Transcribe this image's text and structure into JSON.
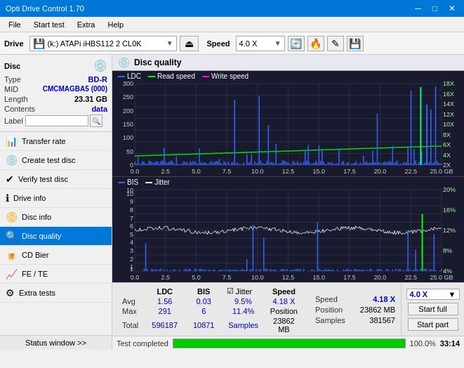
{
  "titleBar": {
    "title": "Opti Drive Control 1.70",
    "minimize": "─",
    "maximize": "□",
    "close": "✕"
  },
  "menuBar": {
    "items": [
      "File",
      "Start test",
      "Extra",
      "Help"
    ]
  },
  "toolbar": {
    "driveLabel": "Drive",
    "driveText": "(k:) ATAPi iHBS112  2 CL0K",
    "speedLabel": "Speed",
    "speedValue": "4.0 X"
  },
  "discPanel": {
    "label": "Disc",
    "type": "BD-R",
    "mid": "CMCMAGBA5 (000)",
    "length": "23.31 GB",
    "contents": "data",
    "labelText": ""
  },
  "navItems": [
    {
      "id": "transfer-rate",
      "label": "Transfer rate",
      "icon": "📊"
    },
    {
      "id": "create-test-disc",
      "label": "Create test disc",
      "icon": "💿"
    },
    {
      "id": "verify-test-disc",
      "label": "Verify test disc",
      "icon": "✔"
    },
    {
      "id": "drive-info",
      "label": "Drive info",
      "icon": "ℹ"
    },
    {
      "id": "disc-info",
      "label": "Disc info",
      "icon": "📀"
    },
    {
      "id": "disc-quality",
      "label": "Disc quality",
      "icon": "🔍",
      "active": true
    },
    {
      "id": "cd-bier",
      "label": "CD Bier",
      "icon": "📀"
    },
    {
      "id": "fe-te",
      "label": "FE / TE",
      "icon": "📈"
    },
    {
      "id": "extra-tests",
      "label": "Extra tests",
      "icon": "⚙"
    }
  ],
  "statusWindow": "Status window >>",
  "panelHeader": "Disc quality",
  "chart1": {
    "legend": [
      {
        "label": "LDC",
        "color": "#3366ff"
      },
      {
        "label": "Read speed",
        "color": "#00ff00"
      },
      {
        "label": "Write speed",
        "color": "#ff00ff"
      }
    ],
    "yAxisLeft": [
      "300",
      "250",
      "200",
      "150",
      "100",
      "50",
      "0"
    ],
    "yAxisRight": [
      "18X",
      "16X",
      "14X",
      "12X",
      "10X",
      "8X",
      "6X",
      "4X",
      "2X"
    ],
    "xAxis": [
      "0.0",
      "2.5",
      "5.0",
      "7.5",
      "10.0",
      "12.5",
      "15.0",
      "17.5",
      "20.0",
      "22.5",
      "25.0 GB"
    ]
  },
  "chart2": {
    "legend": [
      {
        "label": "BIS",
        "color": "#3366ff"
      },
      {
        "label": "Jitter",
        "color": "#ffffff"
      }
    ],
    "yAxisLeft": [
      "10",
      "9",
      "8",
      "7",
      "6",
      "5",
      "4",
      "3",
      "2",
      "1"
    ],
    "yAxisRight": [
      "20%",
      "16%",
      "12%",
      "8%",
      "4%"
    ],
    "xAxis": [
      "0.0",
      "2.5",
      "5.0",
      "7.5",
      "10.0",
      "12.5",
      "15.0",
      "17.5",
      "20.0",
      "22.5",
      "25.0 GB"
    ]
  },
  "stats": {
    "headers": [
      "LDC",
      "BIS",
      "",
      "Jitter",
      "Speed"
    ],
    "rows": [
      {
        "label": "Avg",
        "ldc": "1.56",
        "bis": "0.03",
        "jitter": "9.5%",
        "speed": "4.18 X"
      },
      {
        "label": "Max",
        "ldc": "291",
        "bis": "6",
        "jitter": "11.4%",
        "position": "23862 MB"
      },
      {
        "label": "Total",
        "ldc": "596187",
        "bis": "10871",
        "samples": "381567"
      }
    ],
    "jitterChecked": true,
    "speedDisplay": "4.18 X",
    "speedDropdown": "4.0 X",
    "positionLabel": "Position",
    "positionVal": "23862 MB",
    "samplesLabel": "Samples",
    "samplesVal": "381567",
    "buttons": {
      "startFull": "Start full",
      "startPart": "Start part"
    }
  },
  "statusBar": {
    "statusText": "Test completed",
    "progressPct": 100,
    "time": "33:14"
  }
}
